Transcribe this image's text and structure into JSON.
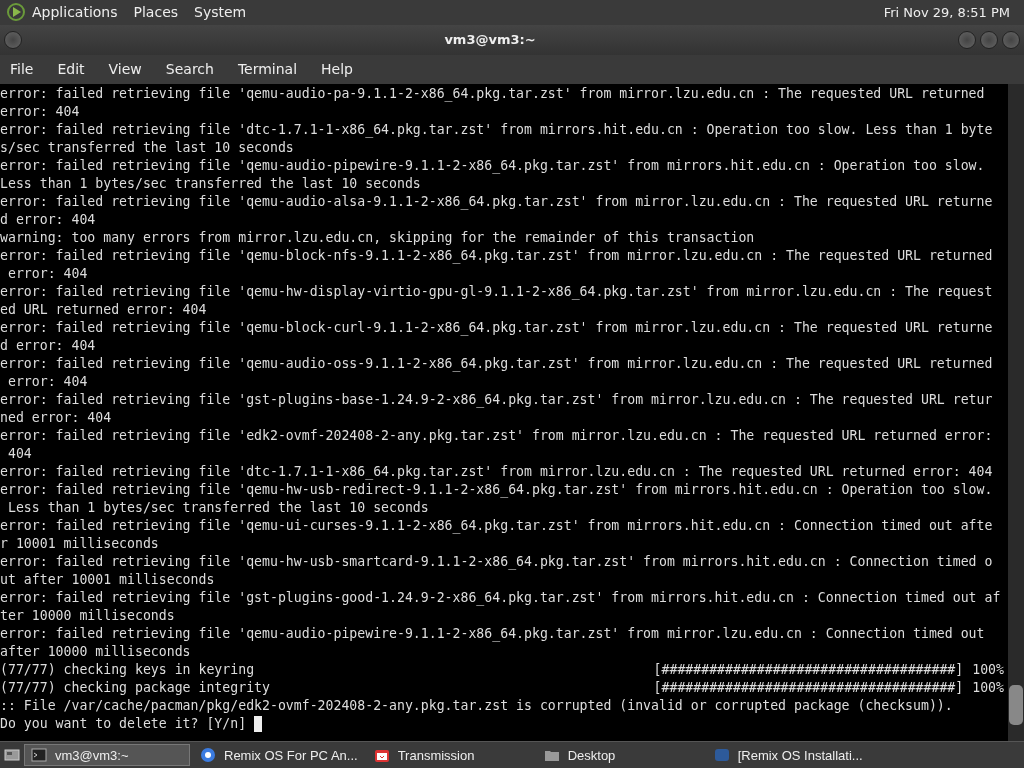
{
  "top_panel": {
    "menus": [
      "Applications",
      "Places",
      "System"
    ],
    "clock": "Fri Nov 29,  8:51 PM"
  },
  "window": {
    "title": "vm3@vm3:~"
  },
  "menu_bar": [
    "File",
    "Edit",
    "View",
    "Search",
    "Terminal",
    "Help"
  ],
  "terminal": {
    "lines": [
      {
        "kind": "text",
        "text": "error: failed retrieving file 'qemu-audio-pa-9.1.1-2-x86_64.pkg.tar.zst' from mirror.lzu.edu.cn : The requested URL returned"
      },
      {
        "kind": "text",
        "text": "error: 404"
      },
      {
        "kind": "text",
        "text": "error: failed retrieving file 'dtc-1.7.1-1-x86_64.pkg.tar.zst' from mirrors.hit.edu.cn : Operation too slow. Less than 1 byte"
      },
      {
        "kind": "text",
        "text": "s/sec transferred the last 10 seconds"
      },
      {
        "kind": "text",
        "text": "error: failed retrieving file 'qemu-audio-pipewire-9.1.1-2-x86_64.pkg.tar.zst' from mirrors.hit.edu.cn : Operation too slow."
      },
      {
        "kind": "text",
        "text": "Less than 1 bytes/sec transferred the last 10 seconds"
      },
      {
        "kind": "text",
        "text": "error: failed retrieving file 'qemu-audio-alsa-9.1.1-2-x86_64.pkg.tar.zst' from mirror.lzu.edu.cn : The requested URL returne"
      },
      {
        "kind": "text",
        "text": "d error: 404"
      },
      {
        "kind": "text",
        "text": "warning: too many errors from mirror.lzu.edu.cn, skipping for the remainder of this transaction"
      },
      {
        "kind": "text",
        "text": "error: failed retrieving file 'qemu-block-nfs-9.1.1-2-x86_64.pkg.tar.zst' from mirror.lzu.edu.cn : The requested URL returned"
      },
      {
        "kind": "text",
        "text": " error: 404"
      },
      {
        "kind": "text",
        "text": "error: failed retrieving file 'qemu-hw-display-virtio-gpu-gl-9.1.1-2-x86_64.pkg.tar.zst' from mirror.lzu.edu.cn : The request"
      },
      {
        "kind": "text",
        "text": "ed URL returned error: 404"
      },
      {
        "kind": "text",
        "text": "error: failed retrieving file 'qemu-block-curl-9.1.1-2-x86_64.pkg.tar.zst' from mirror.lzu.edu.cn : The requested URL returne"
      },
      {
        "kind": "text",
        "text": "d error: 404"
      },
      {
        "kind": "text",
        "text": "error: failed retrieving file 'qemu-audio-oss-9.1.1-2-x86_64.pkg.tar.zst' from mirror.lzu.edu.cn : The requested URL returned"
      },
      {
        "kind": "text",
        "text": " error: 404"
      },
      {
        "kind": "text",
        "text": "error: failed retrieving file 'gst-plugins-base-1.24.9-2-x86_64.pkg.tar.zst' from mirror.lzu.edu.cn : The requested URL retur"
      },
      {
        "kind": "text",
        "text": "ned error: 404"
      },
      {
        "kind": "text",
        "text": "error: failed retrieving file 'edk2-ovmf-202408-2-any.pkg.tar.zst' from mirror.lzu.edu.cn : The requested URL returned error:"
      },
      {
        "kind": "text",
        "text": " 404"
      },
      {
        "kind": "text",
        "text": "error: failed retrieving file 'dtc-1.7.1-1-x86_64.pkg.tar.zst' from mirror.lzu.edu.cn : The requested URL returned error: 404"
      },
      {
        "kind": "text",
        "text": "error: failed retrieving file 'qemu-hw-usb-redirect-9.1.1-2-x86_64.pkg.tar.zst' from mirrors.hit.edu.cn : Operation too slow."
      },
      {
        "kind": "text",
        "text": " Less than 1 bytes/sec transferred the last 10 seconds"
      },
      {
        "kind": "text",
        "text": "error: failed retrieving file 'qemu-ui-curses-9.1.1-2-x86_64.pkg.tar.zst' from mirrors.hit.edu.cn : Connection timed out afte"
      },
      {
        "kind": "text",
        "text": "r 10001 milliseconds"
      },
      {
        "kind": "text",
        "text": "error: failed retrieving file 'qemu-hw-usb-smartcard-9.1.1-2-x86_64.pkg.tar.zst' from mirrors.hit.edu.cn : Connection timed o"
      },
      {
        "kind": "text",
        "text": "ut after 10001 milliseconds"
      },
      {
        "kind": "text",
        "text": "error: failed retrieving file 'gst-plugins-good-1.24.9-2-x86_64.pkg.tar.zst' from mirrors.hit.edu.cn : Connection timed out af"
      },
      {
        "kind": "text",
        "text": "ter 10000 milliseconds"
      },
      {
        "kind": "text",
        "text": "error: failed retrieving file 'qemu-audio-pipewire-9.1.1-2-x86_64.pkg.tar.zst' from mirror.lzu.edu.cn : Connection timed out"
      },
      {
        "kind": "text",
        "text": "after 10000 milliseconds"
      },
      {
        "kind": "progress",
        "text": "(77/77) checking keys in keyring",
        "bar": "[#####################################]",
        "percent": "100%"
      },
      {
        "kind": "progress",
        "text": "(77/77) checking package integrity",
        "bar": "[#####################################]",
        "percent": "100%"
      },
      {
        "kind": "text",
        "text": ":: File /var/cache/pacman/pkg/edk2-ovmf-202408-2-any.pkg.tar.zst is corrupted (invalid or corrupted package (checksum))."
      },
      {
        "kind": "prompt",
        "text": "Do you want to delete it? [Y/n] "
      }
    ]
  },
  "taskbar": [
    {
      "label": "vm3@vm3:~",
      "selected": true,
      "kind": "terminal"
    },
    {
      "label": "Remix OS For PC An...",
      "selected": false,
      "kind": "browser"
    },
    {
      "label": "Transmission",
      "selected": false,
      "kind": "transmission"
    },
    {
      "label": "Desktop",
      "selected": false,
      "kind": "folder"
    },
    {
      "label": "[Remix OS Installati...",
      "selected": false,
      "kind": "app"
    }
  ]
}
